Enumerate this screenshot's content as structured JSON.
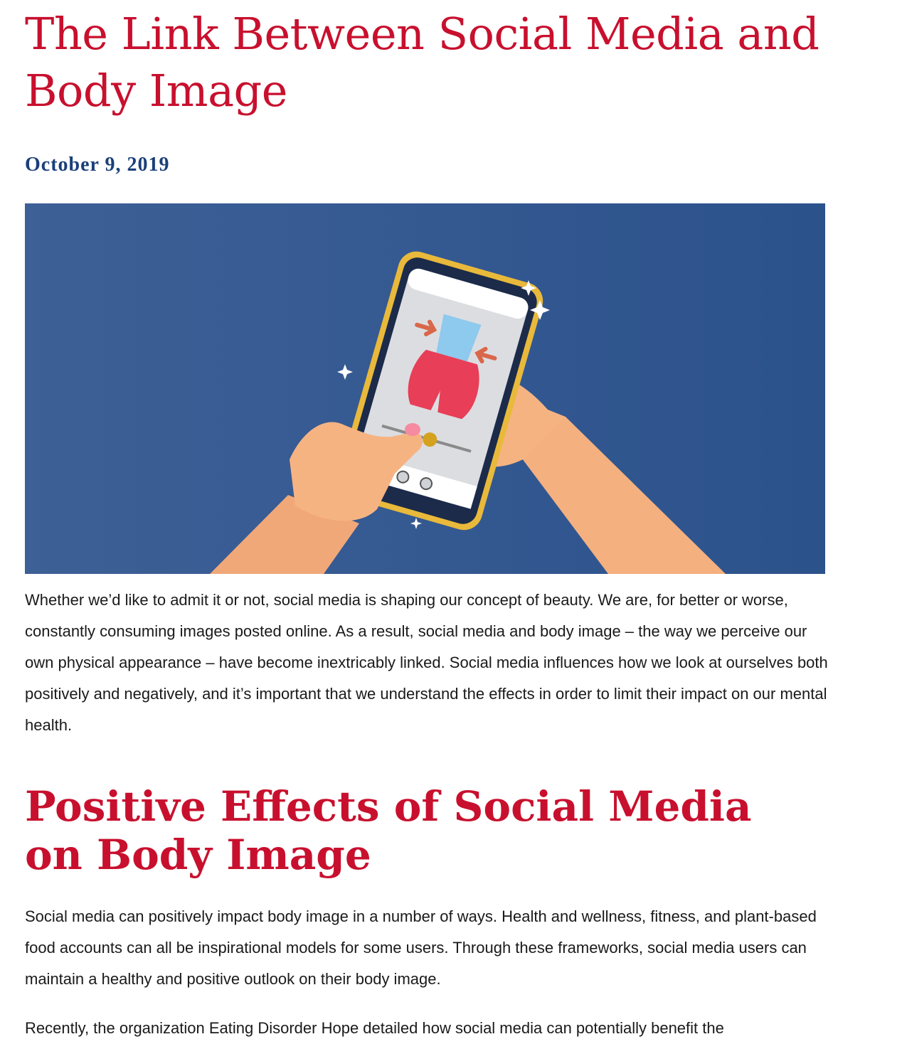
{
  "article": {
    "title": "The Link Between Social Media and Body Image",
    "date": "October 9, 2019",
    "hero_image": {
      "background_color": "#2f5592",
      "description_icons": [
        "smartphone-icon",
        "hands-icon",
        "slider-icon",
        "sparkle-icon"
      ]
    },
    "intro": "Whether we’d like to admit it or not, social media is shaping our concept of beauty. We are, for better or worse, constantly consuming images posted online. As a result, social media and body image – the way we perceive our own physical appearance – have become inextricably linked. Social media influences how we look at ourselves both positively and negatively, and it’s important that we understand the effects in order to limit their impact on our mental health.",
    "sections": [
      {
        "heading": "Positive Effects of Social Media on Body Image",
        "paragraphs": [
          "Social media can positively impact body image in a number of ways. Health and wellness, fitness, and plant-based food accounts can all be inspirational models for some users. Through these frameworks, social media users can maintain a healthy and positive outlook on their body image.",
          "Recently, the organization Eating Disorder Hope detailed how social media can potentially benefit the"
        ]
      }
    ]
  },
  "colors": {
    "title": "#c8102e",
    "date": "#1b3f7a",
    "body_text": "#1a1a1a"
  }
}
